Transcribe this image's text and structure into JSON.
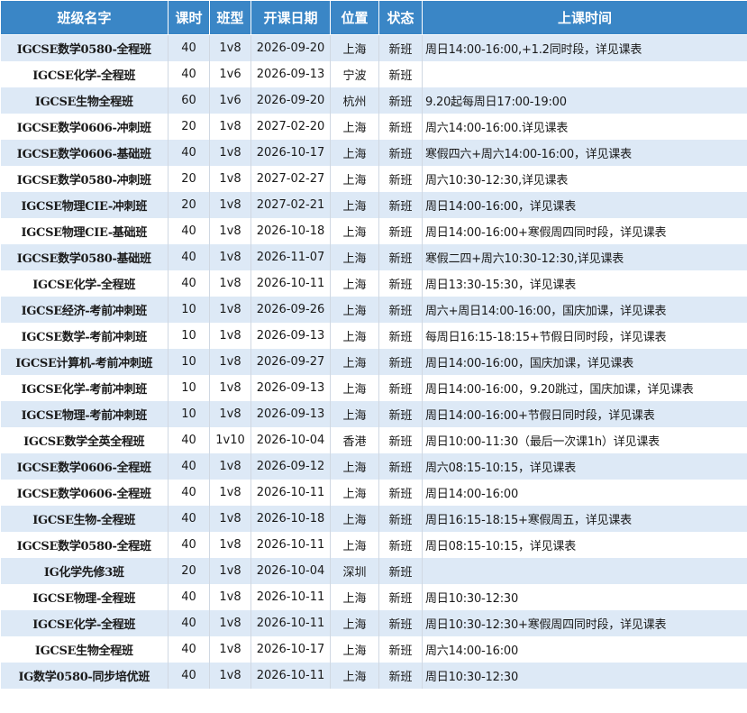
{
  "table": {
    "headers": [
      "班级名字",
      "课时",
      "班型",
      "开课日期",
      "位置",
      "状态",
      "上课时间"
    ],
    "rows": [
      {
        "name": "IGCSE数学0580-全程班",
        "hours": "40",
        "type": "1v8",
        "start": "2026-09-20",
        "location": "上海",
        "status": "新班",
        "schedule": "周日14:00-16:00,+1.2同时段，详见课表"
      },
      {
        "name": "IGCSE化学-全程班",
        "hours": "40",
        "type": "1v6",
        "start": "2026-09-13",
        "location": "宁波",
        "status": "新班",
        "schedule": ""
      },
      {
        "name": "IGCSE生物全程班",
        "hours": "60",
        "type": "1v6",
        "start": "2026-09-20",
        "location": "杭州",
        "status": "新班",
        "schedule": "9.20起每周日17:00-19:00"
      },
      {
        "name": "IGCSE数学0606-冲刺班",
        "hours": "20",
        "type": "1v8",
        "start": "2027-02-20",
        "location": "上海",
        "status": "新班",
        "schedule": "周六14:00-16:00.详见课表"
      },
      {
        "name": "IGCSE数学0606-基础班",
        "hours": "40",
        "type": "1v8",
        "start": "2026-10-17",
        "location": "上海",
        "status": "新班",
        "schedule": "寒假四六+周六14:00-16:00，详见课表"
      },
      {
        "name": "IGCSE数学0580-冲刺班",
        "hours": "20",
        "type": "1v8",
        "start": "2027-02-27",
        "location": "上海",
        "status": "新班",
        "schedule": "周六10:30-12:30,详见课表"
      },
      {
        "name": "IGCSE物理CIE-冲刺班",
        "hours": "20",
        "type": "1v8",
        "start": "2027-02-21",
        "location": "上海",
        "status": "新班",
        "schedule": "周日14:00-16:00，详见课表"
      },
      {
        "name": "IGCSE物理CIE-基础班",
        "hours": "40",
        "type": "1v8",
        "start": "2026-10-18",
        "location": "上海",
        "status": "新班",
        "schedule": "周日14:00-16:00+寒假周四同时段，详见课表"
      },
      {
        "name": "IGCSE数学0580-基础班",
        "hours": "40",
        "type": "1v8",
        "start": "2026-11-07",
        "location": "上海",
        "status": "新班",
        "schedule": "寒假二四+周六10:30-12:30,详见课表"
      },
      {
        "name": "IGCSE化学-全程班",
        "hours": "40",
        "type": "1v8",
        "start": "2026-10-11",
        "location": "上海",
        "status": "新班",
        "schedule": "周日13:30-15:30，详见课表"
      },
      {
        "name": "IGCSE经济-考前冲刺班",
        "hours": "10",
        "type": "1v8",
        "start": "2026-09-26",
        "location": "上海",
        "status": "新班",
        "schedule": "周六+周日14:00-16:00，国庆加课，详见课表"
      },
      {
        "name": "IGCSE数学-考前冲刺班",
        "hours": "10",
        "type": "1v8",
        "start": "2026-09-13",
        "location": "上海",
        "status": "新班",
        "schedule": "每周日16:15-18:15+节假日同时段，详见课表"
      },
      {
        "name": "IGCSE计算机-考前冲刺班",
        "hours": "10",
        "type": "1v8",
        "start": "2026-09-27",
        "location": "上海",
        "status": "新班",
        "schedule": "周日14:00-16:00，国庆加课，详见课表"
      },
      {
        "name": "IGCSE化学-考前冲刺班",
        "hours": "10",
        "type": "1v8",
        "start": "2026-09-13",
        "location": "上海",
        "status": "新班",
        "schedule": "周日14:00-16:00，9.20跳过，国庆加课，详见课表"
      },
      {
        "name": "IGCSE物理-考前冲刺班",
        "hours": "10",
        "type": "1v8",
        "start": "2026-09-13",
        "location": "上海",
        "status": "新班",
        "schedule": "周日14:00-16:00+节假日同时段，详见课表"
      },
      {
        "name": "IGCSE数学全英全程班",
        "hours": "40",
        "type": "1v10",
        "start": "2026-10-04",
        "location": "香港",
        "status": "新班",
        "schedule": "周日10:00-11:30（最后一次课1h）详见课表"
      },
      {
        "name": "IGCSE数学0606-全程班",
        "hours": "40",
        "type": "1v8",
        "start": "2026-09-12",
        "location": "上海",
        "status": "新班",
        "schedule": "周六08:15-10:15，详见课表"
      },
      {
        "name": "IGCSE数学0606-全程班",
        "hours": "40",
        "type": "1v8",
        "start": "2026-10-11",
        "location": "上海",
        "status": "新班",
        "schedule": "周日14:00-16:00"
      },
      {
        "name": "IGCSE生物-全程班",
        "hours": "40",
        "type": "1v8",
        "start": "2026-10-18",
        "location": "上海",
        "status": "新班",
        "schedule": "周日16:15-18:15+寒假周五，详见课表"
      },
      {
        "name": "IGCSE数学0580-全程班",
        "hours": "40",
        "type": "1v8",
        "start": "2026-10-11",
        "location": "上海",
        "status": "新班",
        "schedule": "周日08:15-10:15，详见课表"
      },
      {
        "name": "IG化学先修3班",
        "hours": "20",
        "type": "1v8",
        "start": "2026-10-04",
        "location": "深圳",
        "status": "新班",
        "schedule": ""
      },
      {
        "name": "IGCSE物理-全程班",
        "hours": "40",
        "type": "1v8",
        "start": "2026-10-11",
        "location": "上海",
        "status": "新班",
        "schedule": "周日10:30-12:30"
      },
      {
        "name": "IGCSE化学-全程班",
        "hours": "40",
        "type": "1v8",
        "start": "2026-10-11",
        "location": "上海",
        "status": "新班",
        "schedule": "周日10:30-12:30+寒假周四同时段，详见课表"
      },
      {
        "name": "IGCSE生物全程班",
        "hours": "40",
        "type": "1v8",
        "start": "2026-10-17",
        "location": "上海",
        "status": "新班",
        "schedule": "周六14:00-16:00"
      },
      {
        "name": "IG数学0580-同步培优班",
        "hours": "40",
        "type": "1v8",
        "start": "2026-10-11",
        "location": "上海",
        "status": "新班",
        "schedule": "周日10:30-12:30"
      }
    ]
  }
}
